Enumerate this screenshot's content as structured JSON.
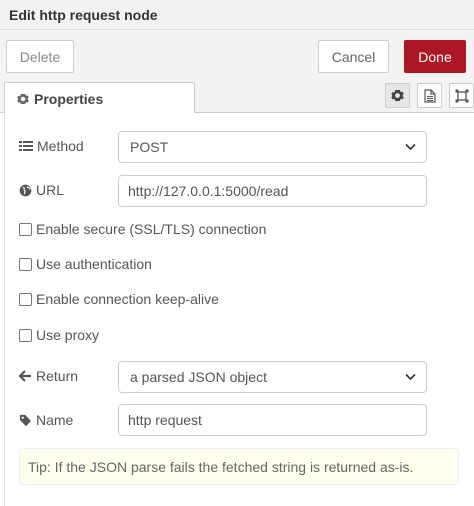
{
  "header": {
    "title": "Edit http request node"
  },
  "toolbar": {
    "delete_label": "Delete",
    "cancel_label": "Cancel",
    "done_label": "Done"
  },
  "tabs": {
    "properties_label": "Properties",
    "icons": [
      "gear-icon",
      "description-icon",
      "appearance-icon"
    ]
  },
  "form": {
    "method": {
      "label": "Method",
      "value": "POST"
    },
    "url": {
      "label": "URL",
      "value": "http://127.0.0.1:5000/read"
    },
    "checkboxes": [
      {
        "label": "Enable secure (SSL/TLS) connection",
        "checked": false
      },
      {
        "label": "Use authentication",
        "checked": false
      },
      {
        "label": "Enable connection keep-alive",
        "checked": false
      },
      {
        "label": "Use proxy",
        "checked": false
      }
    ],
    "return": {
      "label": "Return",
      "value": "a parsed JSON object"
    },
    "name": {
      "label": "Name",
      "value": "http request"
    }
  },
  "tip": "Tip: If the JSON parse fails the fetched string is returned as-is.",
  "colors": {
    "done_button": "#ad1625",
    "header_bg": "#f3f3f3",
    "tip_bg": "#ffffee"
  }
}
